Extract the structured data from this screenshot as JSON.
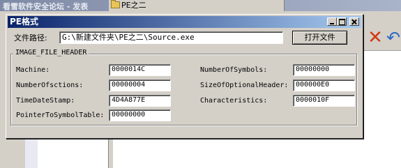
{
  "background_app": {
    "title": "看雪软件安全论坛 - 发表",
    "tab": "PE之二",
    "toolbar_icons": [
      "delete-icon",
      "undo-icon"
    ]
  },
  "dialog": {
    "title": "PE格式",
    "file_path_label": "文件路径:",
    "file_path_value": "G:\\新建文件夹\\PE之二\\Source.exe",
    "open_button": "打开文件",
    "group_title": "IMAGE_FILE_HEADER",
    "fields": {
      "machine": {
        "label": "Machine:",
        "value": "0000014C"
      },
      "number_of_sections": {
        "label": "NumberOfsctions:",
        "value": "00000004"
      },
      "time_date_stamp": {
        "label": "TimeDateStamp:",
        "value": "4D4A877E"
      },
      "pointer_to_symbol_table": {
        "label": "PointerToSymbolTable:",
        "value": "00000000"
      },
      "number_of_symbols": {
        "label": "NumberOfSymbols:",
        "value": "00000000"
      },
      "size_of_optional_header": {
        "label": "SizeOfOptionalHeader:",
        "value": "000000E0"
      },
      "characteristics": {
        "label": "Characteristics:",
        "value": "0000010F"
      }
    }
  }
}
